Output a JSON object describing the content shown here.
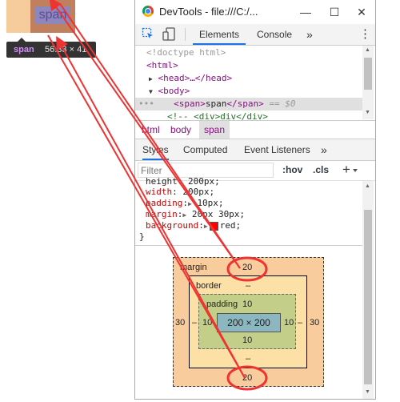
{
  "preview": {
    "span_text": "span",
    "tooltip_tag": "span",
    "tooltip_size": "56.33 × 41"
  },
  "window": {
    "title": "DevTools - file:///C:/...",
    "minimize": "—",
    "maximize": "☐",
    "close": "✕"
  },
  "tabs": {
    "elements": "Elements",
    "console": "Console",
    "more": "»",
    "menu": "⋮"
  },
  "dom": {
    "doctype": "<!doctype html>",
    "html_open": "<html>",
    "head": "<head>…</head>",
    "body_open": "<body>",
    "span_line": "== $0",
    "span_open": "<span>",
    "span_text": "span",
    "span_close": "</span>",
    "comment": "<!--   <div>div</div>"
  },
  "breadcrumb": [
    "html",
    "body",
    "span"
  ],
  "subtabs": {
    "styles": "Styles",
    "computed": "Computed",
    "listeners": "Event Listeners",
    "more": "»"
  },
  "filter": {
    "placeholder": "Filter",
    "hov": ":hov",
    "cls": ".cls",
    "add": "+"
  },
  "css": {
    "partial": "height: 200px;",
    "width_prop": "width",
    "width_val": "200px;",
    "padding_prop": "padding",
    "padding_val": "10px;",
    "margin_prop": "margin",
    "margin_val": "20px 30px;",
    "background_prop": "background",
    "background_val": "red;",
    "close_brace": "}"
  },
  "boxmodel": {
    "margin_label": "margin",
    "margin_top": "20",
    "margin_bottom": "20",
    "margin_left": "30",
    "margin_right": "30",
    "border_label": "border",
    "border_top": "–",
    "border_bottom": "–",
    "border_left": "–",
    "border_right": "–",
    "padding_label": "padding",
    "padding_top": "10",
    "padding_bottom": "10",
    "padding_left": "10",
    "padding_right": "10",
    "content": "200 × 200"
  },
  "colors": {
    "annotation": "#ee3333",
    "margin": "#f9cc9d",
    "border": "#fce0a5",
    "padding": "#c3cf89",
    "content": "#8cb6c0"
  }
}
